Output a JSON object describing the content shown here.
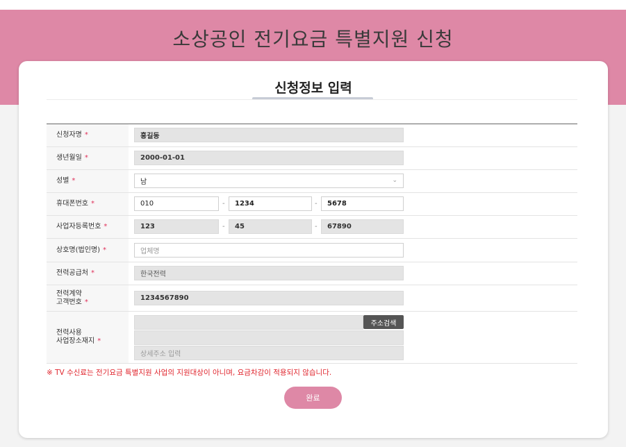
{
  "banner": {
    "title": "소상공인 전기요금 특별지원 신청"
  },
  "card": {
    "title": "신청정보 입력"
  },
  "required_mark": "*",
  "fields": {
    "name": {
      "label": "신청자명",
      "value": "홍길동"
    },
    "birth": {
      "label": "생년월일",
      "value": "2000-01-01"
    },
    "gender": {
      "label": "성별",
      "value": "남"
    },
    "phone": {
      "label": "휴대폰번호",
      "part1": "010",
      "part2": "1234",
      "part3": "5678",
      "separator": "-"
    },
    "bizno": {
      "label": "사업자등록번호",
      "part1": "123",
      "part2": "45",
      "part3": "67890"
    },
    "company": {
      "label": "상호명(법인명)",
      "placeholder": "업체명"
    },
    "supplier": {
      "label": "전력공급처",
      "value": "한국전력"
    },
    "contract": {
      "label_line1": "전력계약",
      "label_line2": "고객번호",
      "value": "1234567890"
    },
    "address": {
      "label_line1": "전력사용",
      "label_line2": "사업장소재지",
      "search_button": "주소검색",
      "detail_placeholder": "상세주소 입력"
    }
  },
  "notice": "※ TV 수신료는 전기요금 특별지원 사업의 지원대상이 아니며, 요금차감이 적용되지 않습니다.",
  "submit": {
    "label": "완료"
  },
  "colors": {
    "accent": "#de88a6",
    "required": "#e0305a",
    "notice": "#e0262e"
  }
}
